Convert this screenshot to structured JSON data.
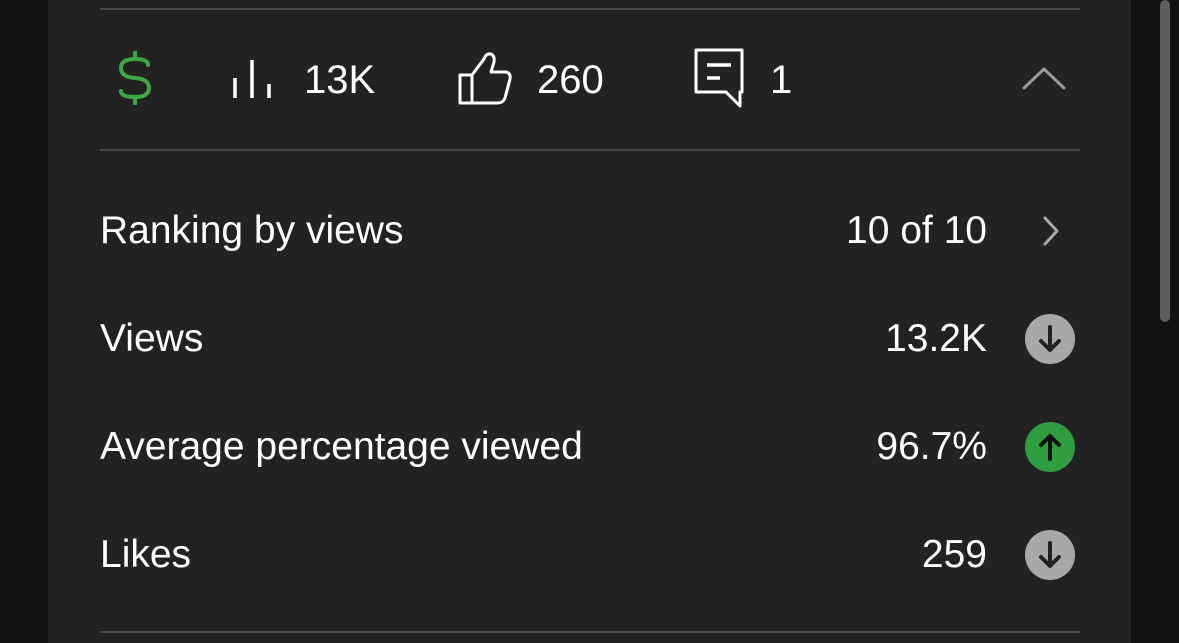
{
  "stats": {
    "views": "13K",
    "likes": "260",
    "comments": "1"
  },
  "metrics": [
    {
      "label": "Ranking by views",
      "value": "10 of 10",
      "indicator": "chevron-right"
    },
    {
      "label": "Views",
      "value": "13.2K",
      "indicator": "trend-down"
    },
    {
      "label": "Average percentage viewed",
      "value": "96.7%",
      "indicator": "trend-up"
    },
    {
      "label": "Likes",
      "value": "259",
      "indicator": "trend-down"
    }
  ],
  "colors": {
    "panel": "#222222",
    "monetization_green": "#3ca843",
    "trend_up_green": "#2e9e3f",
    "trend_down_grey": "#a8a8a8",
    "divider": "#4a4a4a"
  },
  "icons": {
    "monetization": "dollar-icon",
    "views": "bar-chart-icon",
    "likes": "thumbs-up-icon",
    "comments": "comment-icon",
    "collapse": "chevron-up-icon"
  }
}
